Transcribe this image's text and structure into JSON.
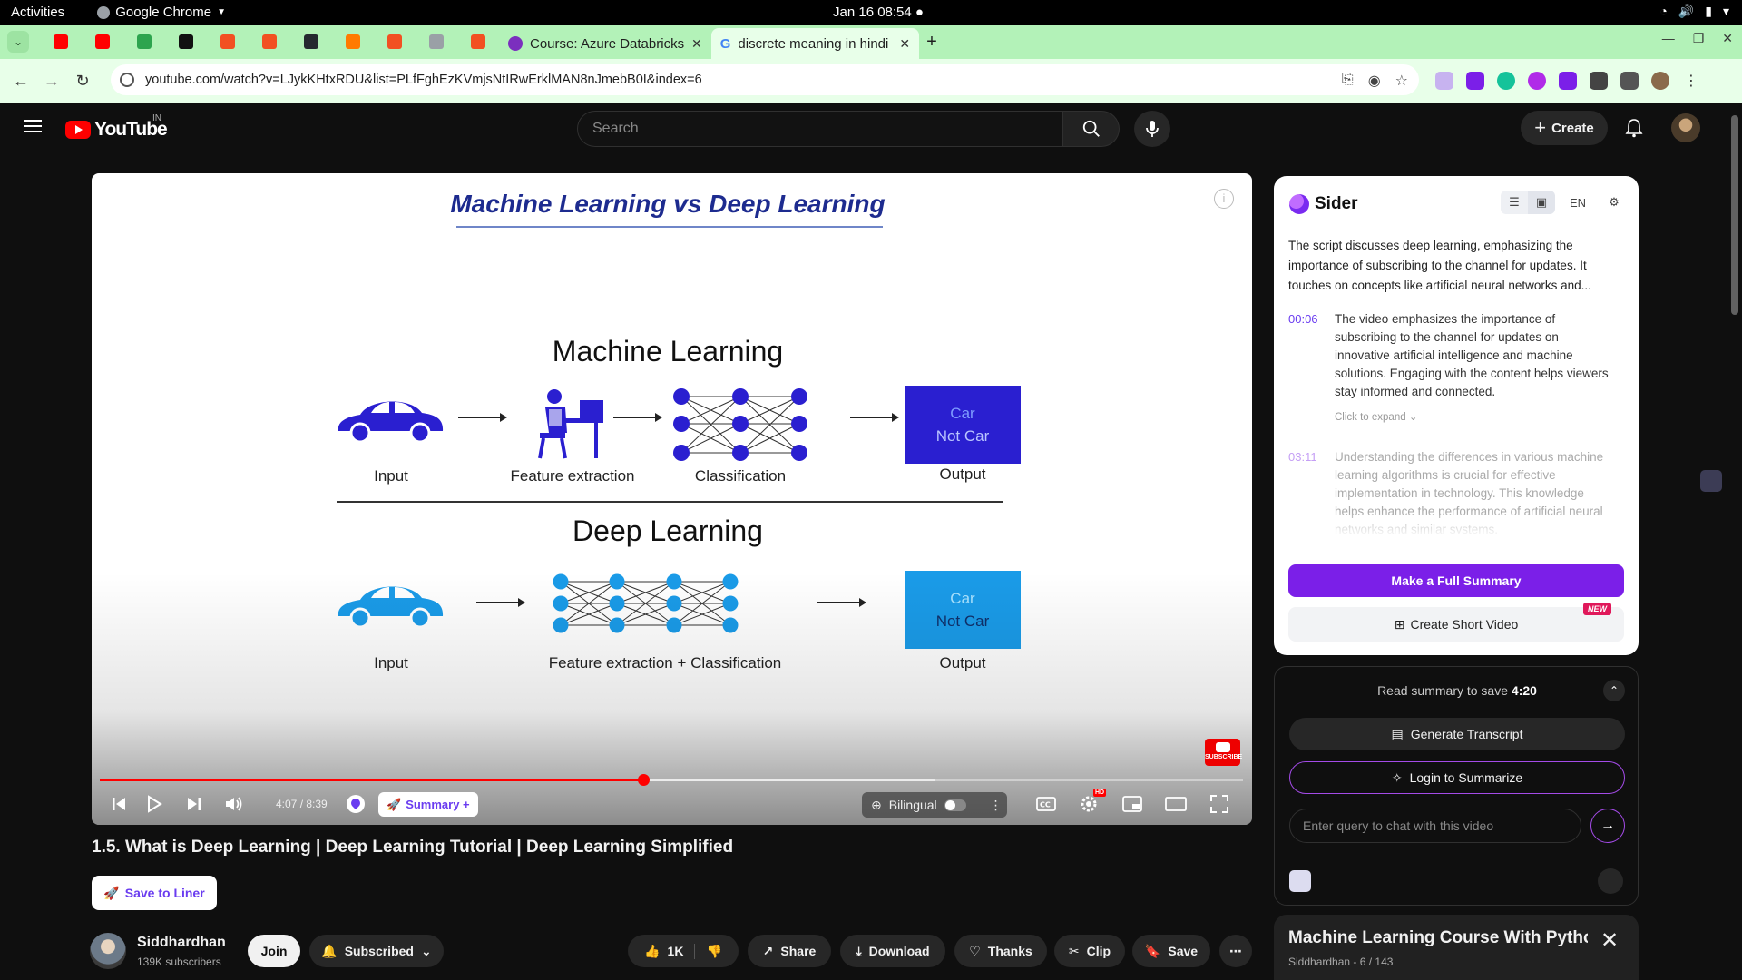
{
  "os": {
    "activities": "Activities",
    "app_name": "Google Chrome",
    "clock": "Jan 16  08:54"
  },
  "browser": {
    "tabs": [
      {
        "label": "Course: Azure Databricks",
        "favicon_color": "#7b2fbe"
      },
      {
        "label": "discrete meaning in hindi",
        "favicon_color": "#4285f4"
      }
    ],
    "url": "youtube.com/watch?v=LJykKHtxRDU&list=PLfFghEzKVmjsNtIRwErklMAN8nJmebB0I&index=6",
    "pinned_favicons": [
      "#ff0000",
      "#ff0000",
      "#2da44e",
      "#111111",
      "#f25022",
      "#f25022",
      "#24292f",
      "#ff7a00",
      "#f25022",
      "#9aa0a6",
      "#f25022"
    ]
  },
  "youtube": {
    "country": "IN",
    "logo_text": "YouTube",
    "search_placeholder": "Search",
    "create_label": "Create"
  },
  "video": {
    "slide_title": "Machine Learning vs Deep Learning",
    "ml_heading": "Machine Learning",
    "dl_heading": "Deep Learning",
    "ml_labels": {
      "input": "Input",
      "feature": "Feature extraction",
      "classify": "Classification",
      "output": "Output"
    },
    "dl_labels": {
      "input": "Input",
      "feature": "Feature extraction + Classification",
      "output": "Output"
    },
    "output_box": {
      "line1": "Car",
      "line2": "Not Car"
    },
    "colors": {
      "ml": "#2a1fd0",
      "dl": "#1a9be8",
      "title": "#1d2b8f"
    },
    "subscribe_watermark": "SUBSCRIBE",
    "time_current": "4:07",
    "time_total": "8:39",
    "progress_played": 0.475,
    "progress_loaded": 0.73,
    "summary_label": "Summary +",
    "bilingual_label": "Bilingual",
    "title": "1.5. What is Deep Learning | Deep Learning Tutorial | Deep Learning Simplified",
    "save_to_liner": "Save to Liner"
  },
  "channel": {
    "name": "Siddhardhan",
    "subscribers": "139K subscribers",
    "join": "Join",
    "subscribed": "Subscribed",
    "likes": "1K",
    "share": "Share",
    "download": "Download",
    "thanks": "Thanks",
    "clip": "Clip",
    "save": "Save"
  },
  "sider": {
    "brand": "Sider",
    "lang": "EN",
    "summary": "The script discusses deep learning, emphasizing the importance of subscribing to the channel for updates. It touches on concepts like artificial neural networks and...",
    "points": [
      {
        "time": "00:06",
        "text": "The video emphasizes the importance of subscribing to the channel for updates on innovative artificial intelligence and machine solutions. Engaging with the content helps viewers stay informed and connected."
      },
      {
        "time": "03:11",
        "text": "Understanding the differences in various machine learning algorithms is crucial for effective implementation in technology. This knowledge helps enhance the performance of artificial neural networks and similar systems."
      }
    ],
    "click_to_expand": "Click to expand",
    "full_summary_btn": "Make a Full Summary",
    "short_video_btn": "Create Short Video",
    "new_badge": "NEW",
    "save_prefix": "Read summary to save",
    "save_time": "4:20",
    "generate_transcript": "Generate Transcript",
    "login_to_summarize": "Login to Summarize",
    "chat_placeholder": "Enter query to chat with this video"
  },
  "playlist": {
    "title": "Machine Learning Course With Python",
    "subtitle": "Siddhardhan - 6 / 143"
  }
}
